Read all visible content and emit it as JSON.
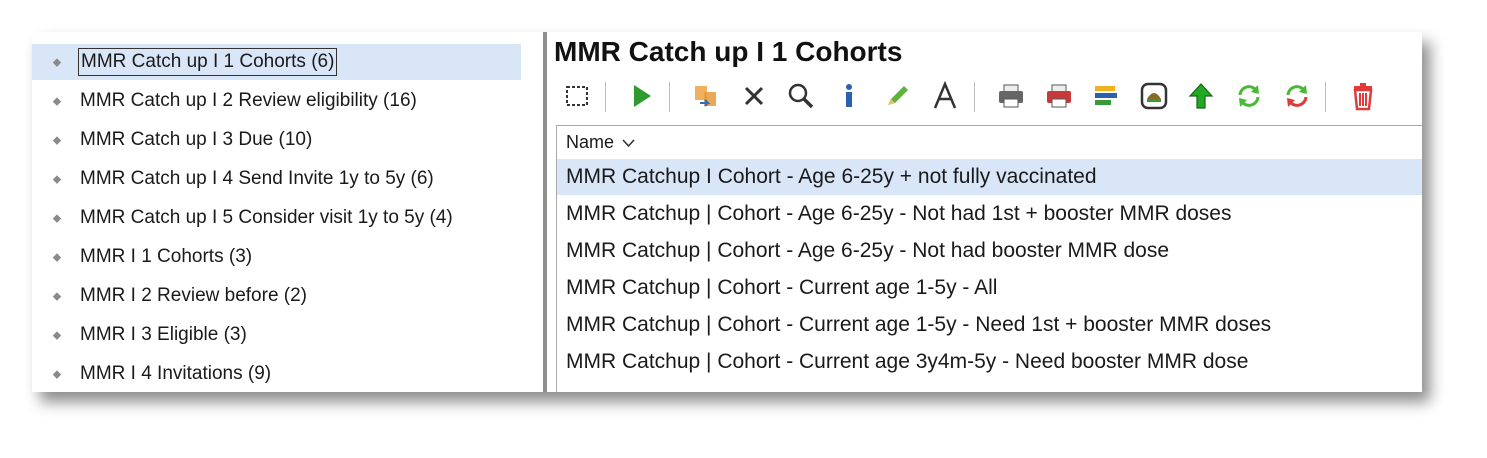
{
  "tree": {
    "items": [
      {
        "label": "MMR Catch up I 1 Cohorts (6)"
      },
      {
        "label": "MMR Catch up I 2 Review eligibility (16)"
      },
      {
        "label": "MMR Catch up I 3 Due (10)"
      },
      {
        "label": "MMR Catch up I 4 Send Invite 1y to 5y (6)"
      },
      {
        "label": "MMR Catch up I 5 Consider visit 1y to 5y (4)"
      },
      {
        "label": "MMR I 1 Cohorts (3)"
      },
      {
        "label": "MMR I 2 Review before (2)"
      },
      {
        "label": "MMR I 3 Eligible (3)"
      },
      {
        "label": "MMR I 4 Invitations (9)"
      }
    ],
    "bullet": "◆"
  },
  "main": {
    "title": "MMR Catch up I 1 Cohorts",
    "column_header": "Name",
    "rows": [
      {
        "label": "MMR Catchup I Cohort - Age 6-25y + not fully vaccinated"
      },
      {
        "label": "MMR Catchup | Cohort - Age 6-25y - Not had 1st + booster MMR doses"
      },
      {
        "label": "MMR Catchup | Cohort - Age 6-25y - Not had booster MMR dose"
      },
      {
        "label": "MMR Catchup | Cohort - Current age 1-5y - All"
      },
      {
        "label": "MMR Catchup | Cohort - Current age 1-5y - Need 1st + booster MMR doses"
      },
      {
        "label": "MMR Catchup | Cohort - Current age 3y4m-5y - Need booster MMR dose"
      }
    ]
  },
  "toolbar": {
    "icons": [
      "select-icon",
      "run-icon",
      "transfer-icon",
      "delete-x-icon",
      "search-icon",
      "info-icon",
      "edit-pencil-icon",
      "font-icon",
      "print-icon",
      "print-red-icon",
      "report-icon",
      "preview-icon",
      "upload-arrow-icon",
      "refresh-icon",
      "refresh-red-icon",
      "trash-icon"
    ]
  },
  "colors": {
    "selection": "#d9e6f8",
    "accent_green": "#2e9b2e",
    "accent_red": "#e03a3a"
  }
}
